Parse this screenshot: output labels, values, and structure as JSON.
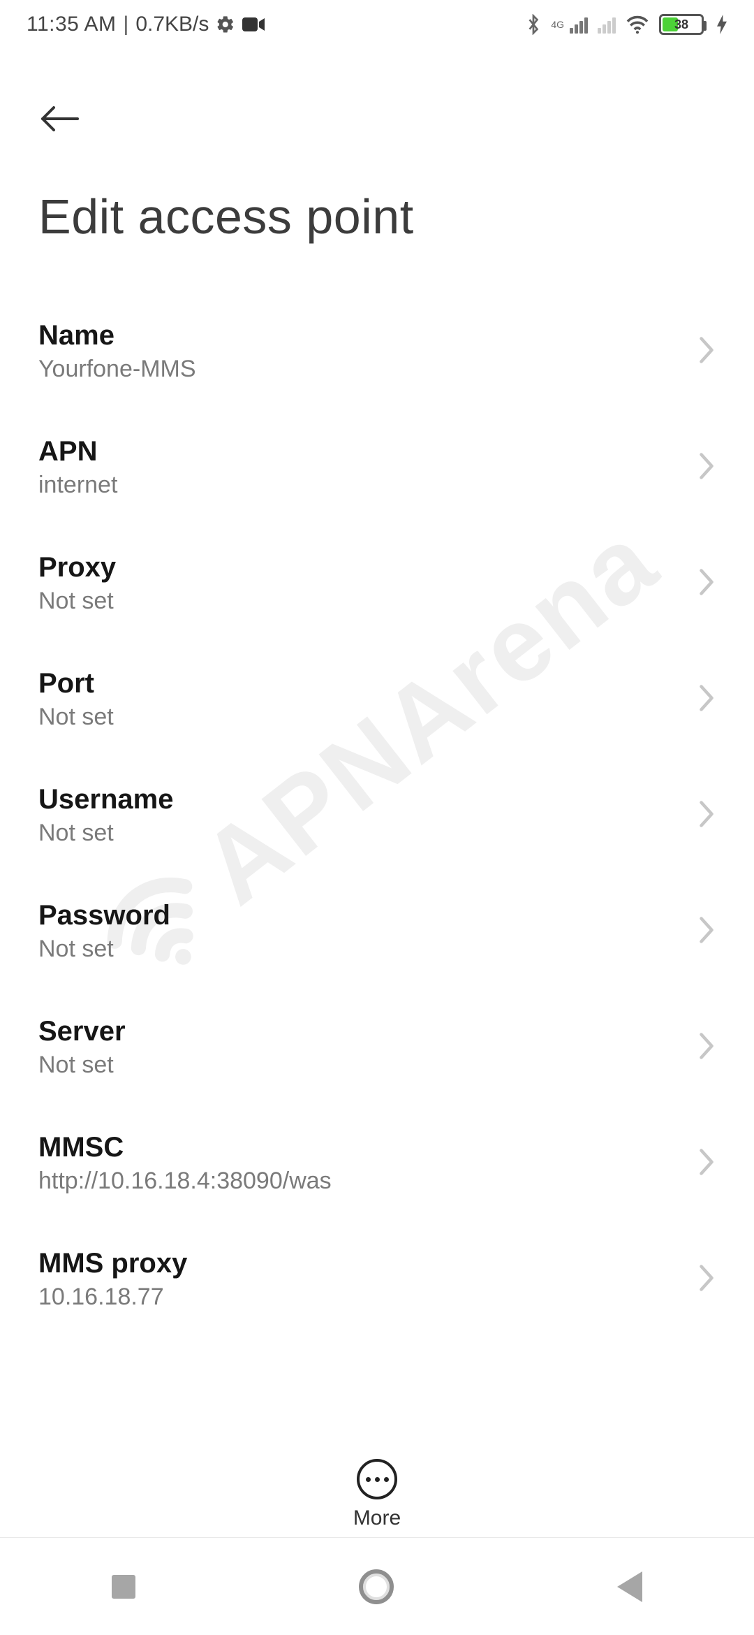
{
  "status": {
    "time": "11:35 AM",
    "speed": "0.7KB/s",
    "network_label": "4G",
    "battery_percent": "38"
  },
  "header": {
    "title": "Edit access point"
  },
  "settings": {
    "name": {
      "label": "Name",
      "value": "Yourfone-MMS"
    },
    "apn": {
      "label": "APN",
      "value": "internet"
    },
    "proxy": {
      "label": "Proxy",
      "value": "Not set"
    },
    "port": {
      "label": "Port",
      "value": "Not set"
    },
    "username": {
      "label": "Username",
      "value": "Not set"
    },
    "password": {
      "label": "Password",
      "value": "Not set"
    },
    "server": {
      "label": "Server",
      "value": "Not set"
    },
    "mmsc": {
      "label": "MMSC",
      "value": "http://10.16.18.4:38090/was"
    },
    "mms_proxy": {
      "label": "MMS proxy",
      "value": "10.16.18.77"
    }
  },
  "footer": {
    "more_label": "More"
  },
  "watermark": "APNArena"
}
